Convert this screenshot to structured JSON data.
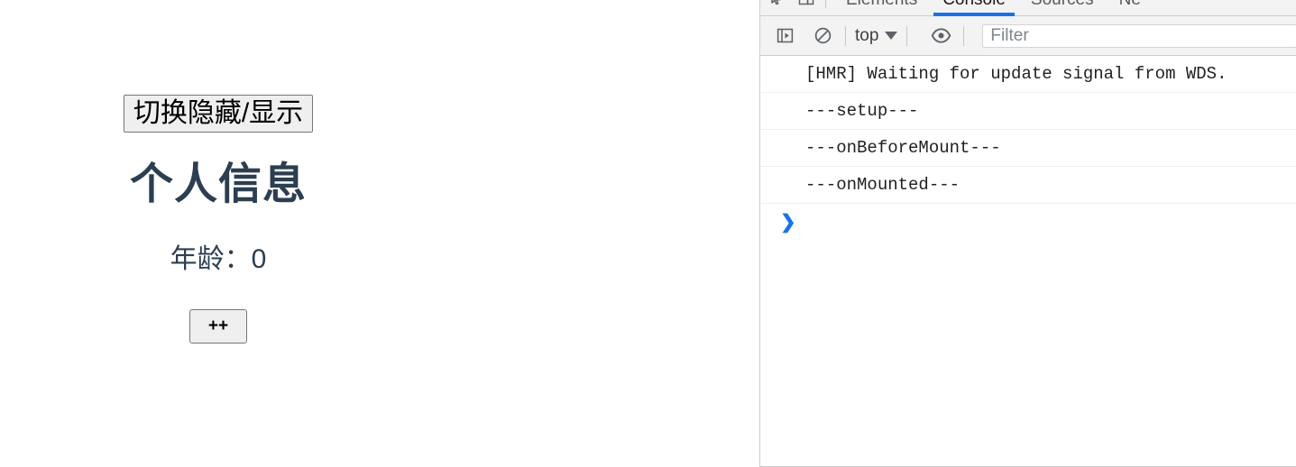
{
  "page": {
    "toggle_button_label": "切换隐藏/显示",
    "title": "个人信息",
    "age_line": "年龄：0",
    "increment_button_label": "++",
    "text_color": "#2c3e50"
  },
  "devtools": {
    "tabs": [
      {
        "label": "Elements",
        "active": false
      },
      {
        "label": "Console",
        "active": true
      },
      {
        "label": "Sources",
        "active": false
      },
      {
        "label": "Ne",
        "active": false
      }
    ],
    "tab_icons": [
      {
        "name": "inspect-element-icon"
      },
      {
        "name": "device-toolbar-icon"
      }
    ],
    "active_tab_accent": "#1a73e8",
    "toolbar": {
      "sidebar_toggle_icon": "console-sidebar-icon",
      "clear_console_icon": "clear-console-icon",
      "context_label": "top",
      "eye_icon": "live-expression-icon",
      "filter_placeholder": "Filter",
      "filter_value": ""
    },
    "console_messages": [
      "[HMR] Waiting for update signal from WDS.",
      "---setup---",
      "---onBeforeMount---",
      "---onMounted---"
    ],
    "prompt_symbol": "❯"
  }
}
